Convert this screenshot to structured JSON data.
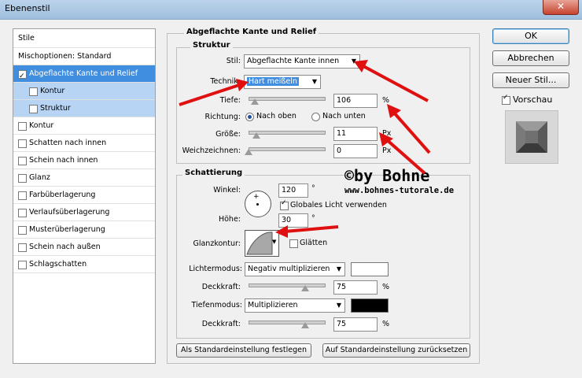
{
  "window": {
    "title": "Ebenenstil",
    "close_glyph": "✕"
  },
  "styles_list": {
    "header": "Stile",
    "items": [
      {
        "label": "Mischoptionen: Standard",
        "checkbox": false,
        "checked": false
      },
      {
        "label": "Abgeflachte Kante und Relief",
        "checkbox": true,
        "checked": true
      },
      {
        "label": "Kontur",
        "checkbox": true,
        "checked": false
      },
      {
        "label": "Struktur",
        "checkbox": true,
        "checked": false
      },
      {
        "label": "Kontur",
        "checkbox": true,
        "checked": false
      },
      {
        "label": "Schatten nach innen",
        "checkbox": true,
        "checked": false
      },
      {
        "label": "Schein nach innen",
        "checkbox": true,
        "checked": false
      },
      {
        "label": "Glanz",
        "checkbox": true,
        "checked": false
      },
      {
        "label": "Farbüberlagerung",
        "checkbox": true,
        "checked": false
      },
      {
        "label": "Verlaufsüberlagerung",
        "checkbox": true,
        "checked": false
      },
      {
        "label": "Musterüberlagerung",
        "checkbox": true,
        "checked": false
      },
      {
        "label": "Schein nach außen",
        "checkbox": true,
        "checked": false
      },
      {
        "label": "Schlagschatten",
        "checkbox": true,
        "checked": false
      }
    ]
  },
  "bevel": {
    "title": "Abgeflachte Kante und Relief",
    "structure": {
      "title": "Struktur",
      "style_label": "Stil:",
      "style_value": "Abgeflachte Kante innen",
      "technique_label": "Technik:",
      "technique_value": "Hart meißeln",
      "depth_label": "Tiefe:",
      "depth_value": "106",
      "depth_unit": "%",
      "direction_label": "Richtung:",
      "direction_up": "Nach oben",
      "direction_down": "Nach unten",
      "size_label": "Größe:",
      "size_value": "11",
      "size_unit": "Px",
      "soften_label": "Weichzeichnen:",
      "soften_value": "0",
      "soften_unit": "Px"
    },
    "shading": {
      "title": "Schattierung",
      "angle_label": "Winkel:",
      "angle_value": "120",
      "angle_unit": "°",
      "global_light_label": "Globales Licht verwenden",
      "altitude_label": "Höhe:",
      "altitude_value": "30",
      "altitude_unit": "°",
      "gloss_label": "Glanzkontur:",
      "smooth_label": "Glätten",
      "highlight_label": "Lichtermodus:",
      "highlight_value": "Negativ multiplizieren",
      "highlight_color": "#ffffff",
      "highlight_opacity_label": "Deckkraft:",
      "highlight_opacity": "75",
      "highlight_opacity_unit": "%",
      "shadow_label": "Tiefenmodus:",
      "shadow_value": "Multiplizieren",
      "shadow_color": "#000000",
      "shadow_opacity_label": "Deckkraft:",
      "shadow_opacity": "75",
      "shadow_opacity_unit": "%"
    },
    "make_default": "Als Standardeinstellung festlegen",
    "reset_default": "Auf Standardeinstellung zurücksetzen"
  },
  "buttons": {
    "ok": "OK",
    "cancel": "Abbrechen",
    "new_style": "Neuer Stil...",
    "preview": "Vorschau"
  },
  "watermark": {
    "line1": "©by Bohne",
    "line2": "www.bohnes-tutorale.de"
  },
  "slider_levels": {
    "depth": 0.08,
    "size": 0.1,
    "soften": 0.0,
    "highlight_opacity": 0.75,
    "shadow_opacity": 0.75
  }
}
